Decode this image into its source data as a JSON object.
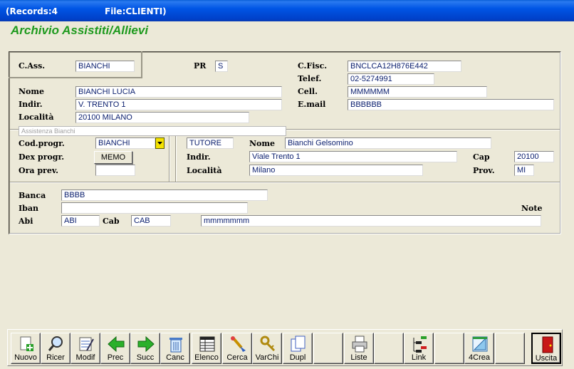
{
  "title_bar": {
    "records": "(Records:4",
    "file": "File:CLIENTI)"
  },
  "heading": "Archivio Assistiti/Allievi",
  "form": {
    "cass_label": "C.Ass.",
    "cass_value": "BIANCHI",
    "pr_label": "PR",
    "pr_value": "S",
    "cfisc_label": "C.Fisc.",
    "cfisc_value": "BNCLCA12H876E442",
    "telef_label": "Telef.",
    "telef_value": "02-5274991",
    "nome_label": "Nome",
    "nome_value": "BIANCHI LUCIA",
    "cell_label": "Cell.",
    "cell_value": "MMMMMM",
    "indir_label": "Indir.",
    "indir_value": "V. TRENTO 1",
    "email_label": "E.mail",
    "email_value": "BBBBBB",
    "localita_label": "Località",
    "localita_value": "20100  MILANO",
    "group_caption": "Assistenza Bianchi",
    "codprogr_label": "Cod.progr.",
    "codprogr_value": "BIANCHI",
    "dexprogr_label": "Dex progr.",
    "memo_button": "MEMO",
    "oraprev_label": "Ora prev.",
    "oraprev_value": "",
    "tutore_value": "TUTORE",
    "t_nome_label": "Nome",
    "t_nome_value": "Bianchi Gelsomino",
    "t_indir_label": "Indir.",
    "t_indir_value": "Viale Trento 1",
    "cap_label": "Cap",
    "cap_value": "20100",
    "t_localita_label": "Località",
    "t_localita_value": "Milano",
    "prov_label": "Prov.",
    "prov_value": "MI",
    "banca_label": "Banca",
    "banca_value": "BBBB",
    "iban_label": "Iban",
    "iban_value": "",
    "note_label": "Note",
    "abi_label": "Abi",
    "abi_value": "ABI",
    "cab_label": "Cab",
    "cab_value": "CAB",
    "note_value": "mmmmmmm"
  },
  "toolbar": [
    {
      "label": "Nuovo",
      "icon": "new-doc-icon"
    },
    {
      "label": "Ricer",
      "icon": "magnifier-icon"
    },
    {
      "label": "Modif",
      "icon": "edit-doc-icon"
    },
    {
      "label": "Prec",
      "icon": "arrow-left-icon"
    },
    {
      "label": "Succ",
      "icon": "arrow-right-icon"
    },
    {
      "label": "Canc",
      "icon": "trash-icon"
    },
    {
      "label": "Elenco",
      "icon": "list-icon"
    },
    {
      "label": "Cerca",
      "icon": "search-brush-icon"
    },
    {
      "label": "VarChi",
      "icon": "keys-icon"
    },
    {
      "label": "Dupl",
      "icon": "duplicate-icon"
    },
    {
      "label": "",
      "icon": ""
    },
    {
      "label": "Liste",
      "icon": "printer-icon"
    },
    {
      "label": "",
      "icon": ""
    },
    {
      "label": "Link",
      "icon": "tree-icon"
    },
    {
      "label": "",
      "icon": ""
    },
    {
      "label": "4Crea",
      "icon": "design-icon"
    },
    {
      "label": "",
      "icon": ""
    },
    {
      "label": "Uscita",
      "icon": "exit-door-icon"
    }
  ],
  "colors": {
    "title_bar": "#0055e5",
    "heading": "#1e9a1e",
    "field_text": "#0a1e6e",
    "window_bg": "#ece9d8"
  }
}
